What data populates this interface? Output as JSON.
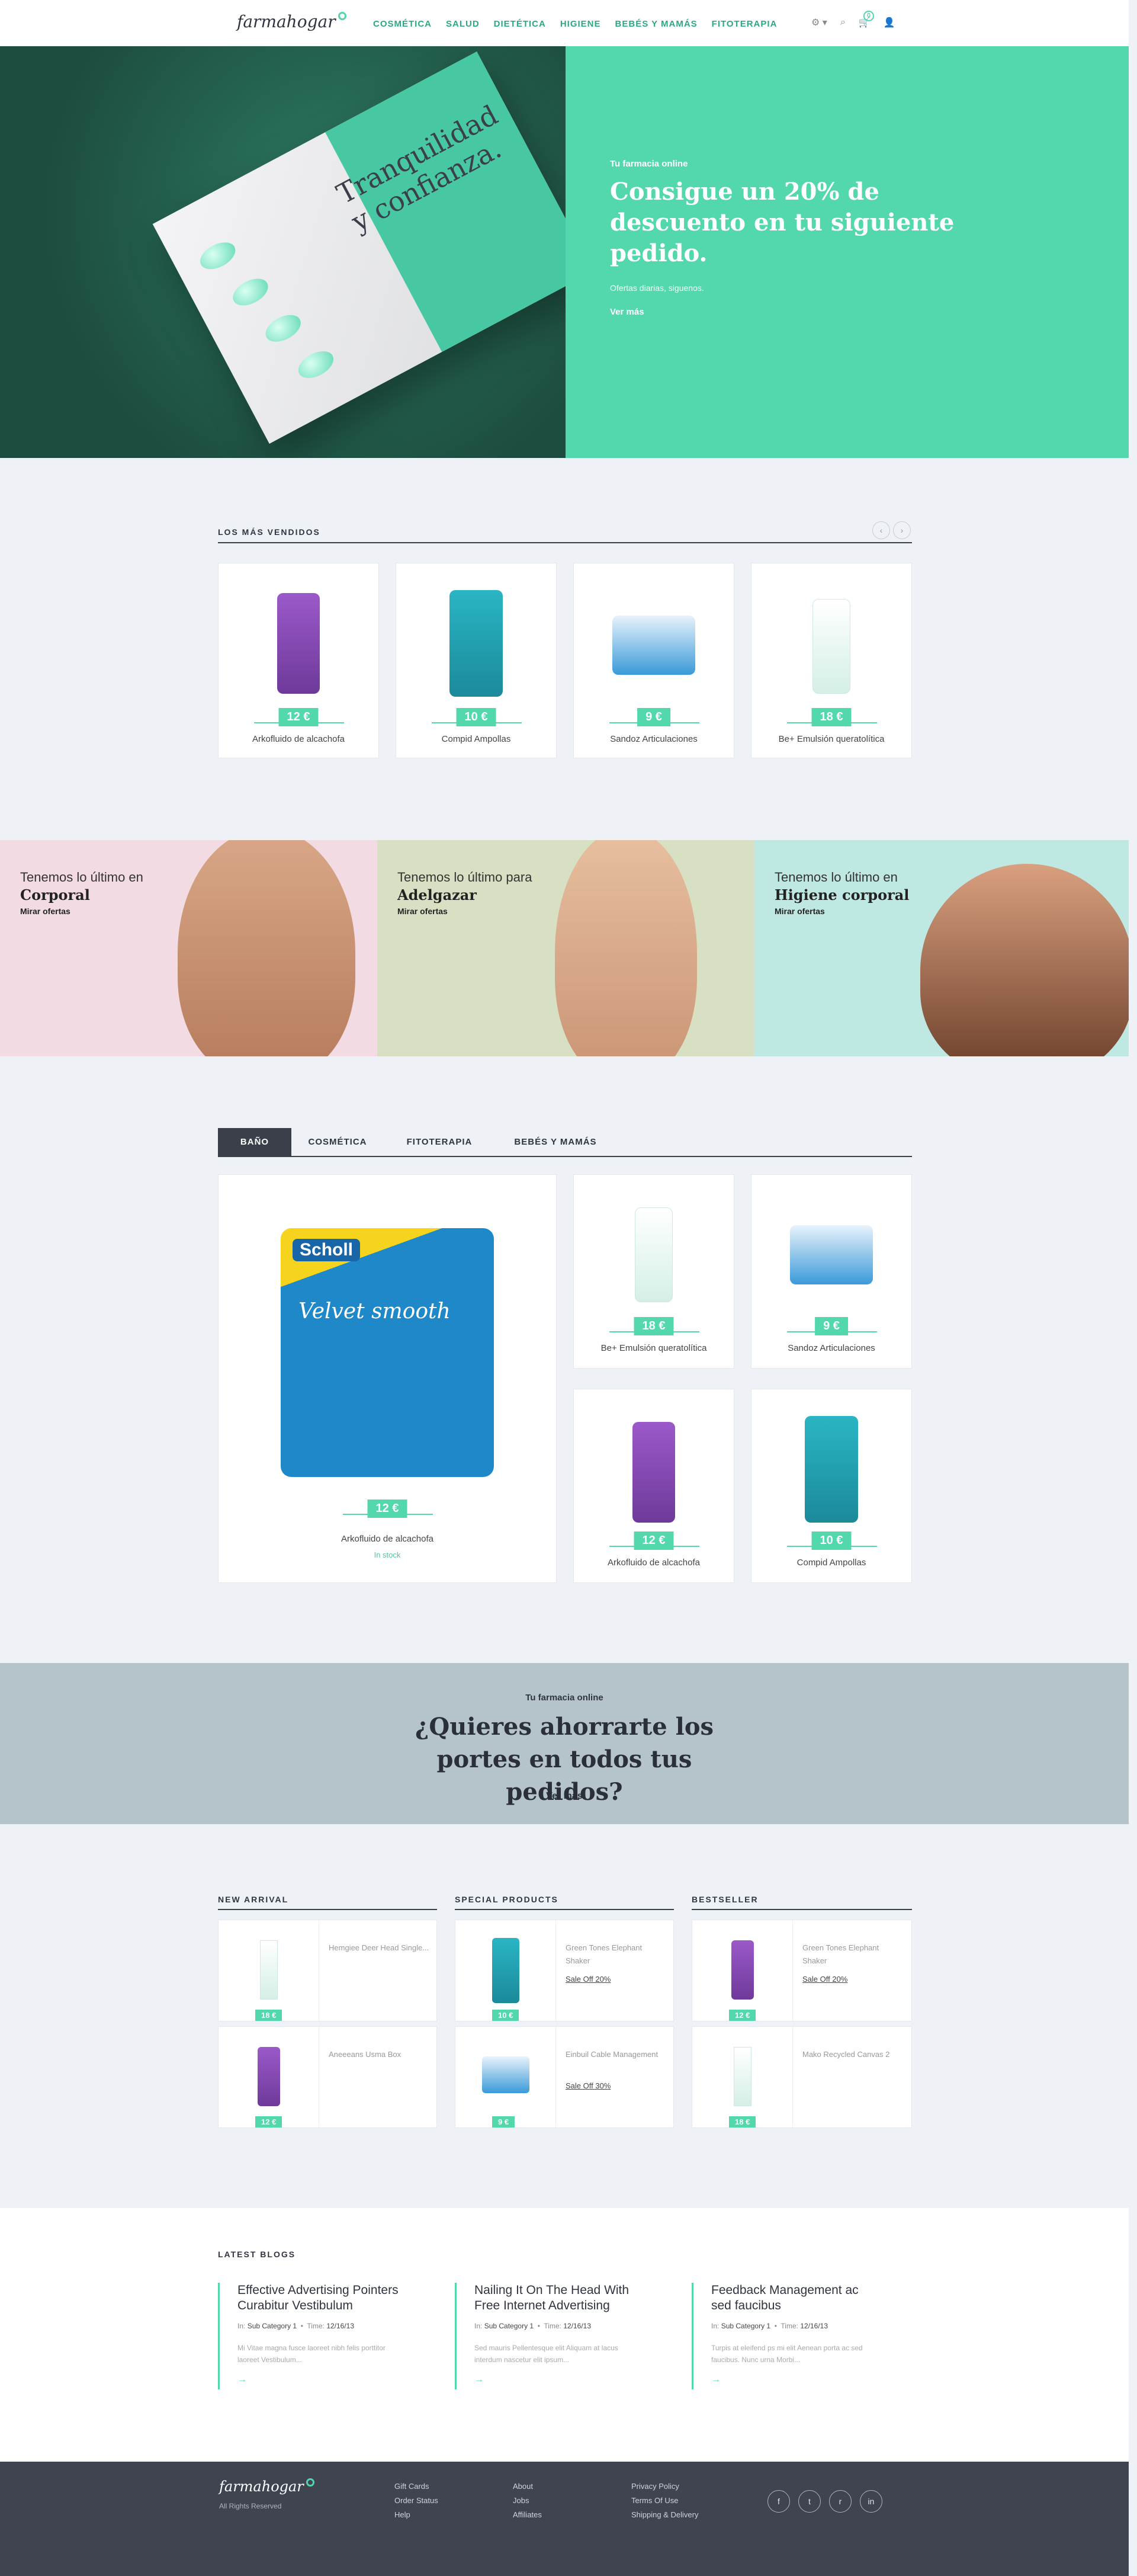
{
  "header": {
    "logo": "farmahogar",
    "nav": [
      "COSMÉTICA",
      "SALUD",
      "DIETÉTICA",
      "HIGIENE",
      "BEBÉS Y MAMÁS",
      "FITOTERAPIA"
    ],
    "cart_count": "0"
  },
  "hero": {
    "box_text": "Tranquilidad y confianza.",
    "kicker": "Tu farmacia online",
    "title": "Consigue un 20% de descuento en tu siguiente pedido.",
    "subtitle": "Ofertas diarias, siguenos.",
    "link": "Ver más"
  },
  "best_sellers": {
    "title": "LOS MÁS VENDIDOS",
    "products": [
      {
        "name": "Arkofluido de alcachofa",
        "price": "12 €"
      },
      {
        "name": "Compid Ampollas",
        "price": "10 €"
      },
      {
        "name": "Sandoz Articulaciones",
        "price": "9 €"
      },
      {
        "name": "Be+ Emulsión queratolítica",
        "price": "18 €"
      }
    ]
  },
  "banners": [
    {
      "pre": "Tenemos lo último en",
      "big": "Corporal",
      "link": "Mirar ofertas"
    },
    {
      "pre": "Tenemos lo último para",
      "big": "Adelgazar",
      "link": "Mirar ofertas"
    },
    {
      "pre": "Tenemos lo último en",
      "big": "Higiene corporal",
      "link": "Mirar ofertas"
    }
  ],
  "tabs": {
    "items": [
      "BAÑO",
      "COSMÉTICA",
      "FITOTERAPIA",
      "BEBÉS Y MAMÁS"
    ],
    "featured": {
      "name": "Arkofluido de alcachofa",
      "price": "12 €",
      "stock": "In stock",
      "brand": "Scholl",
      "product": "Velvet smooth"
    },
    "grid": [
      {
        "name": "Be+ Emulsión queratolítica",
        "price": "18 €"
      },
      {
        "name": "Sandoz Articulaciones",
        "price": "9 €"
      },
      {
        "name": "Arkofluido de alcachofa",
        "price": "12 €"
      },
      {
        "name": "Compid Ampollas",
        "price": "10 €"
      }
    ]
  },
  "promo": {
    "kicker": "Tu farmacia online",
    "title": "¿Quieres ahorrarte los portes en todos tus pedidos?",
    "link": "Ver más"
  },
  "lists": [
    {
      "title": "NEW ARRIVAL",
      "items": [
        {
          "name": "Hemgiee Deer Head Single...",
          "price": "18 €",
          "sale": ""
        },
        {
          "name": "Aneeeans Usma Box",
          "price": "12 €",
          "sale": ""
        }
      ]
    },
    {
      "title": "SPECIAL PRODUCTS",
      "items": [
        {
          "name": "Green Tones Elephant Shaker",
          "price": "10 €",
          "sale": "Sale Off 20%"
        },
        {
          "name": "Einbuil Cable Management",
          "price": "9 €",
          "sale": "Sale Off 30%"
        }
      ]
    },
    {
      "title": "BESTSELLER",
      "items": [
        {
          "name": "Green Tones Elephant Shaker",
          "price": "12 €",
          "sale": "Sale Off 20%"
        },
        {
          "name": "Mako Recycled Canvas 2",
          "price": "18 €",
          "sale": ""
        }
      ]
    }
  ],
  "blogs": {
    "title": "LATEST BLOGS",
    "items": [
      {
        "title": "Effective Advertising Pointers Curabitur Vestibulum",
        "category": "Sub Category 1",
        "time": "12/16/13",
        "excerpt": "Mi Vitae magna fusce laoreet nibh felis porttitor laoreet Vestibulum..."
      },
      {
        "title": "Nailing It On The Head With Free Internet Advertising",
        "category": "Sub Category 1",
        "time": "12/16/13",
        "excerpt": "Sed mauris Pellentesque elit Aliquam at lacus interdum nascetur elit ipsum..."
      },
      {
        "title": "Feedback Management ac sed faucibus",
        "category": "Sub Category 1",
        "time": "12/16/13",
        "excerpt": "Turpis at eleifend ps mi elit Aenean porta ac sed faucibus. Nunc urna Morbi..."
      }
    ],
    "label_in": "In:",
    "label_time": "Time:"
  },
  "footer": {
    "logo": "farmahogar",
    "rights": "All Rights Reserved",
    "col1": [
      "Gift Cards",
      "Order Status",
      "Help"
    ],
    "col2": [
      "About",
      "Jobs",
      "Affiliates"
    ],
    "col3": [
      "Privacy Policy",
      "Terms Of Use",
      "Shipping & Delivery"
    ],
    "social": [
      "f",
      "t",
      "r",
      "in"
    ]
  }
}
